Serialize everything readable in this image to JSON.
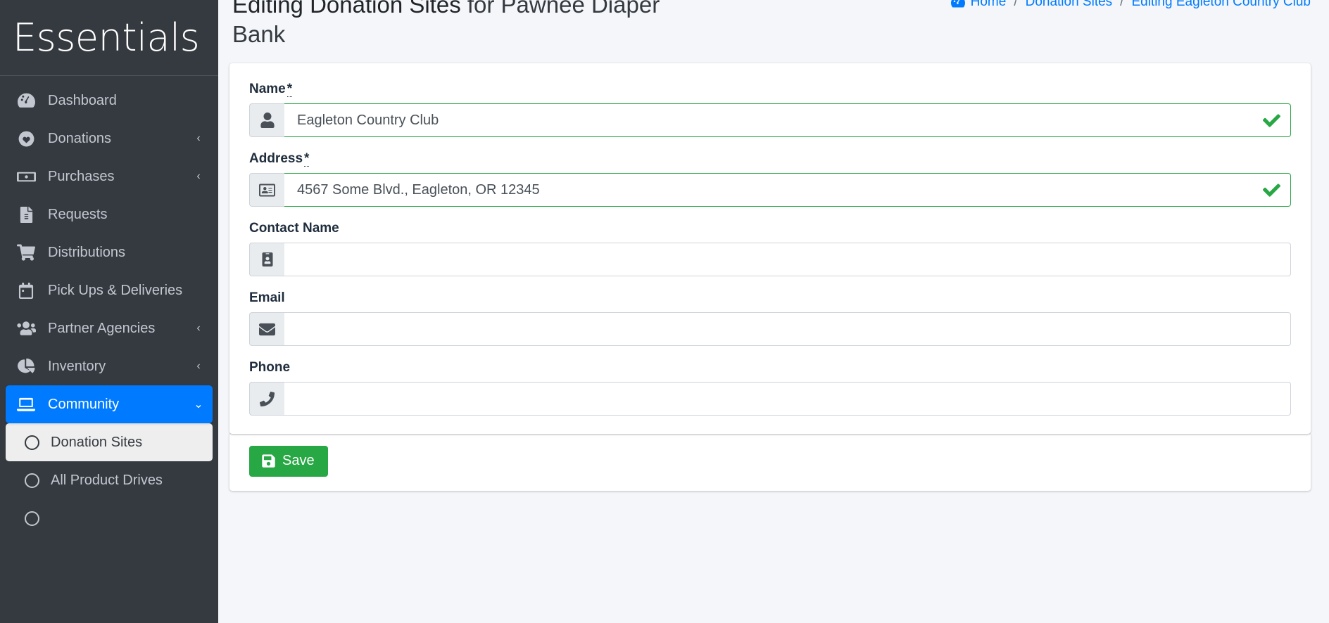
{
  "sidebar": {
    "brand": "Essentials",
    "items": [
      {
        "label": "Dashboard",
        "icon": "gauge-icon",
        "has_chevron": false,
        "active": false
      },
      {
        "label": "Donations",
        "icon": "heart-icon",
        "has_chevron": true,
        "active": false
      },
      {
        "label": "Purchases",
        "icon": "money-bill-icon",
        "has_chevron": true,
        "active": false
      },
      {
        "label": "Requests",
        "icon": "file-lines-icon",
        "has_chevron": false,
        "active": false
      },
      {
        "label": "Distributions",
        "icon": "shopping-cart-icon",
        "has_chevron": false,
        "active": false
      },
      {
        "label": "Pick Ups & Deliveries",
        "icon": "calendar-icon",
        "has_chevron": false,
        "active": false
      },
      {
        "label": "Partner Agencies",
        "icon": "users-icon",
        "has_chevron": true,
        "active": false
      },
      {
        "label": "Inventory",
        "icon": "chart-pie-icon",
        "has_chevron": true,
        "active": false
      },
      {
        "label": "Community",
        "icon": "laptop-icon",
        "has_chevron": true,
        "active": true
      }
    ],
    "subitems": [
      {
        "label": "Donation Sites",
        "active": true
      },
      {
        "label": "All Product Drives",
        "active": false
      }
    ],
    "chevron_collapsed": "‹",
    "chevron_expanded": "⌄"
  },
  "header": {
    "title_strong": "Editing Donation Sites",
    "title_light": " for Pawnee Diaper Bank",
    "breadcrumb": [
      {
        "label": "Home",
        "icon": "gauge-icon"
      },
      {
        "label": "Donation Sites",
        "icon": null
      },
      {
        "label": "Editing Eagleton Country Club",
        "icon": null
      }
    ],
    "breadcrumb_separator": "/"
  },
  "form": {
    "fields": [
      {
        "label": "Name",
        "required": true,
        "required_mark": "*",
        "value": "Eagleton Country Club",
        "placeholder": "",
        "icon": "user-icon",
        "valid": true
      },
      {
        "label": "Address",
        "required": true,
        "required_mark": "*",
        "value": "4567 Some Blvd., Eagleton, OR 12345",
        "placeholder": "",
        "icon": "address-card-icon",
        "valid": true
      },
      {
        "label": "Contact Name",
        "required": false,
        "required_mark": "",
        "value": "",
        "placeholder": "",
        "icon": "id-badge-icon",
        "valid": false
      },
      {
        "label": "Email",
        "required": false,
        "required_mark": "",
        "value": "",
        "placeholder": "",
        "icon": "envelope-icon",
        "valid": false
      },
      {
        "label": "Phone",
        "required": false,
        "required_mark": "",
        "value": "",
        "placeholder": "",
        "icon": "phone-icon",
        "valid": false
      }
    ],
    "save_label": "Save"
  },
  "colors": {
    "sidebar_bg": "#343a40",
    "accent_blue": "#007bff",
    "success_green": "#28a745",
    "page_bg": "#f4f6f9"
  }
}
